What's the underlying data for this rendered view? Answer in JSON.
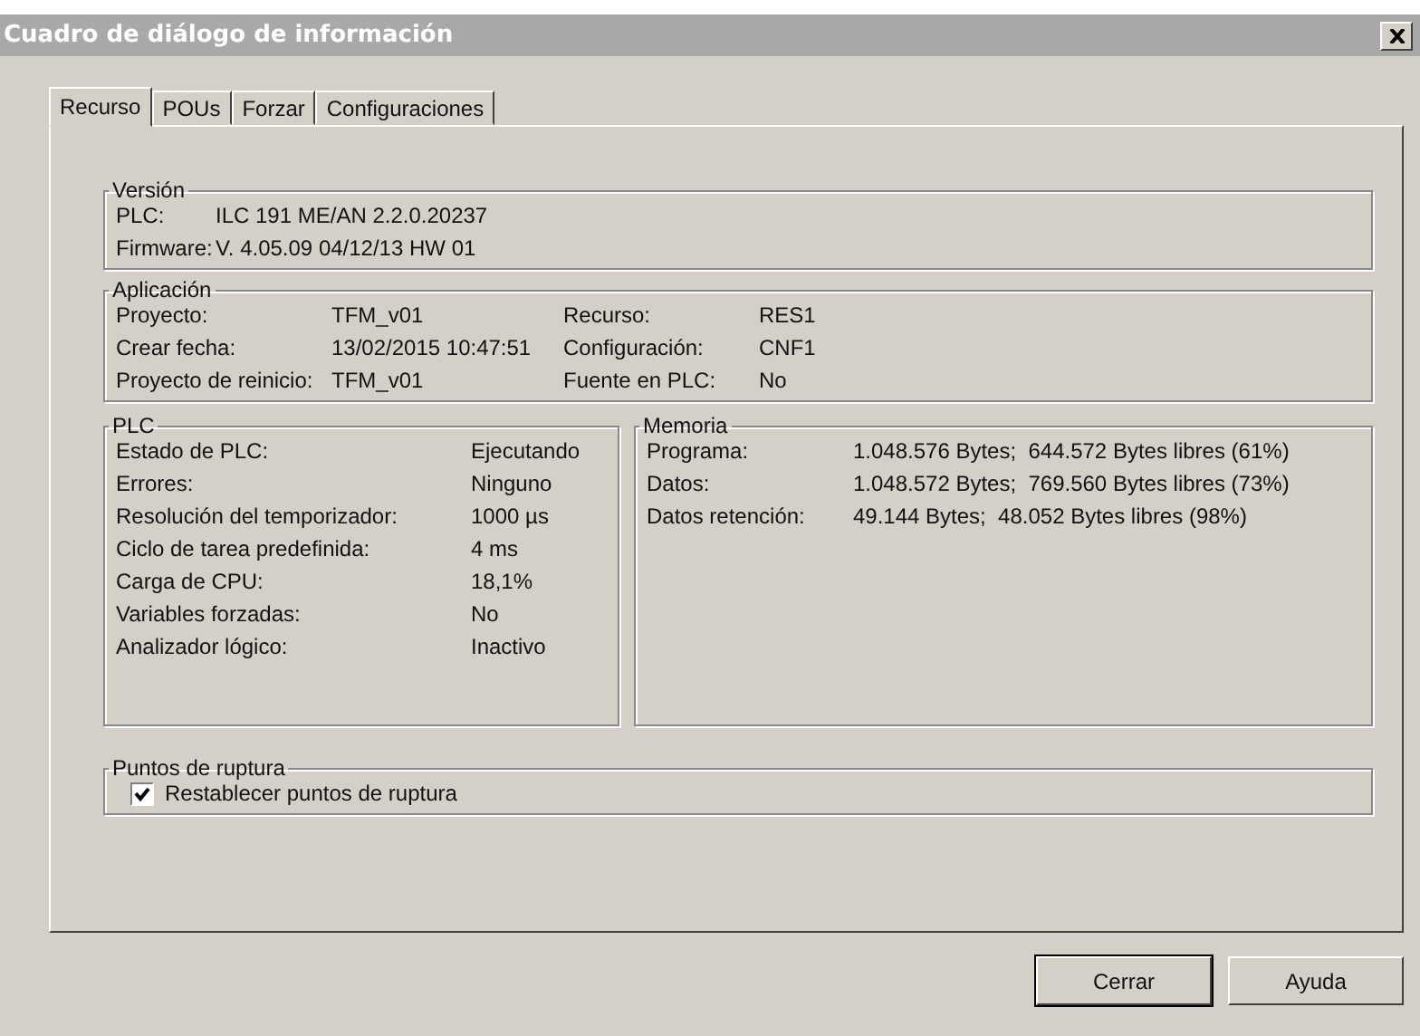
{
  "window": {
    "title": "Cuadro de diálogo de información"
  },
  "tabs": [
    {
      "label": "Recurso",
      "selected": true
    },
    {
      "label": "POUs",
      "selected": false
    },
    {
      "label": "Forzar",
      "selected": false
    },
    {
      "label": "Configuraciones",
      "selected": false
    }
  ],
  "version": {
    "title": "Versión",
    "rows": [
      {
        "label": "PLC:",
        "value": "ILC 191 ME/AN 2.2.0.20237"
      },
      {
        "label": "Firmware:",
        "value": "V. 4.05.09  04/12/13 HW 01"
      }
    ]
  },
  "application": {
    "title": "Aplicación",
    "left": [
      {
        "label": "Proyecto:",
        "value": "TFM_v01"
      },
      {
        "label": "Crear fecha:",
        "value": "13/02/2015 10:47:51"
      },
      {
        "label": "Proyecto de reinicio:",
        "value": "TFM_v01"
      }
    ],
    "right": [
      {
        "label": "Recurso:",
        "value": "RES1"
      },
      {
        "label": "Configuración:",
        "value": "CNF1"
      },
      {
        "label": "Fuente en PLC:",
        "value": "No"
      }
    ]
  },
  "plc": {
    "title": "PLC",
    "rows": [
      {
        "label": "Estado de PLC:",
        "value": "Ejecutando"
      },
      {
        "label": "Errores:",
        "value": "Ninguno"
      },
      {
        "label": "Resolución del temporizador:",
        "value": "1000 µs"
      },
      {
        "label": "Ciclo de tarea predefinida:",
        "value": "4 ms"
      },
      {
        "label": "Carga de CPU:",
        "value": "18,1%"
      },
      {
        "label": "Variables forzadas:",
        "value": "No"
      },
      {
        "label": "Analizador lógico:",
        "value": "Inactivo"
      }
    ]
  },
  "memory": {
    "title": "Memoria",
    "rows": [
      {
        "label": "Programa:",
        "value": "1.048.576 Bytes;  644.572 Bytes libres (61%)"
      },
      {
        "label": "Datos:",
        "value": "1.048.572 Bytes;  769.560 Bytes libres (73%)"
      },
      {
        "label": "Datos retención:",
        "value": "49.144 Bytes;  48.052 Bytes libres (98%)"
      }
    ]
  },
  "breakpoints": {
    "title": "Puntos de ruptura",
    "checkbox": {
      "label": "Restablecer puntos de ruptura",
      "checked": true
    }
  },
  "buttons": [
    {
      "label": "Cerrar",
      "selected": true
    },
    {
      "label": "Ayuda",
      "selected": false
    }
  ]
}
